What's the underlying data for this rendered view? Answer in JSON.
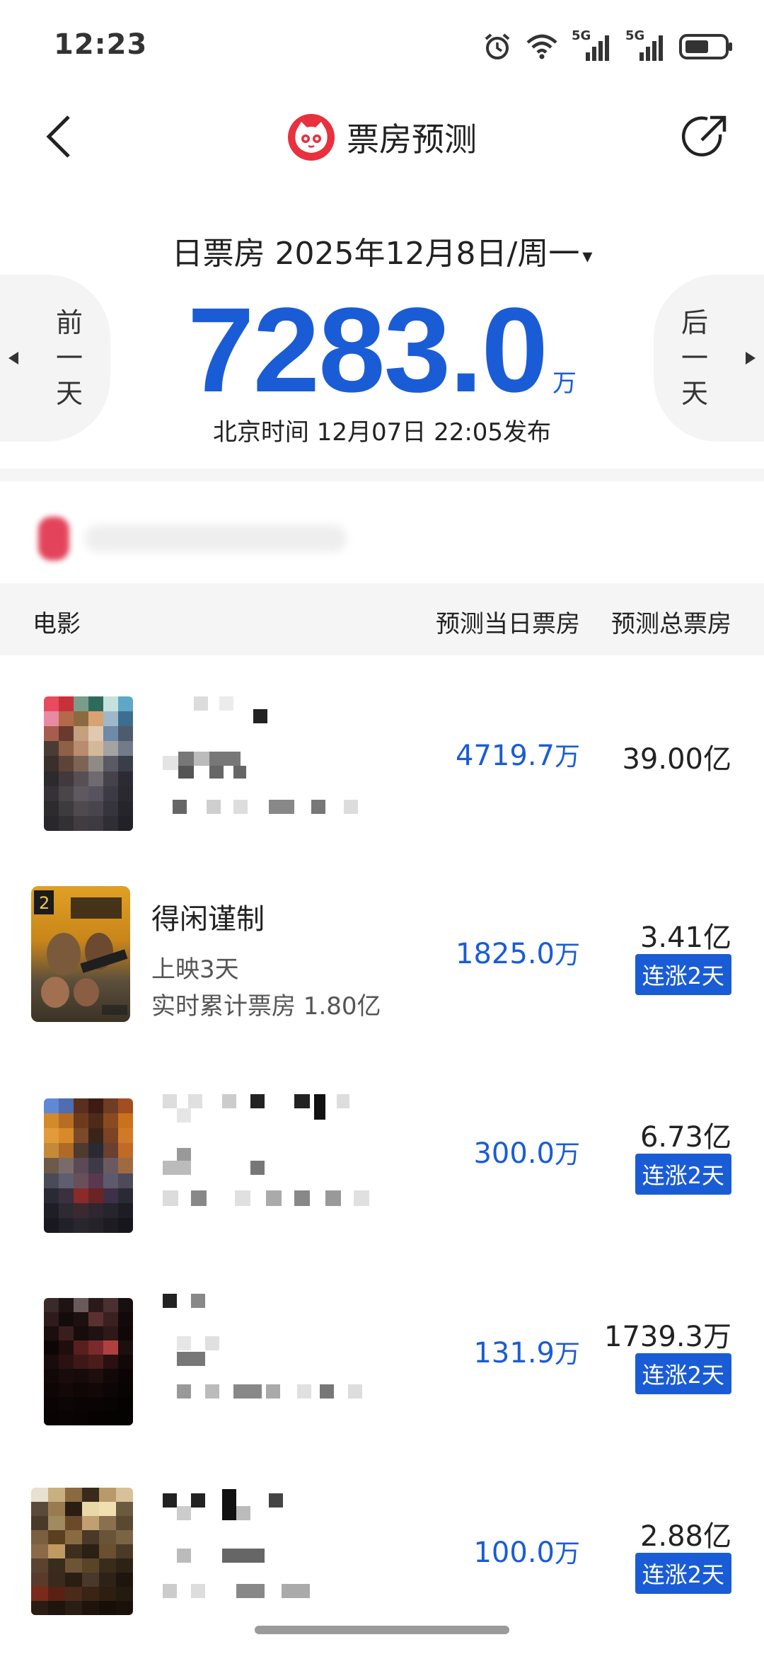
{
  "status_bar": {
    "time": "12:23",
    "icons": [
      "alarm-icon",
      "wifi-icon",
      "signal-5g-icon",
      "signal-5g-icon",
      "battery-icon"
    ],
    "network_1": "5G",
    "network_2": "5G"
  },
  "nav": {
    "title": "票房预测",
    "back_icon": "chevron-left-icon",
    "share_icon": "share-icon",
    "logo_icon": "maoyan-cat-logo"
  },
  "date_selector": {
    "label": "日票房 2025年12月8日/周一",
    "caret": "▾"
  },
  "prev_day": {
    "l1": "前",
    "l2": "一",
    "l3": "天"
  },
  "next_day": {
    "l1": "后",
    "l2": "一",
    "l3": "天"
  },
  "box_office": {
    "value": "7283.0",
    "unit": "万",
    "publish_time": "北京时间  12月07日  22:05发布"
  },
  "table": {
    "headers": {
      "movie": "电影",
      "daily": "预测当日票房",
      "total": "预测总票房"
    },
    "rows": [
      {
        "title": "",
        "sub1": "",
        "sub2": "",
        "daily": "4719.7",
        "daily_unit": "万",
        "total": "39.00",
        "total_unit": "亿",
        "badge": ""
      },
      {
        "title": "得闲谨制",
        "sub1": "上映3天",
        "sub2": "实时累计票房 1.80亿",
        "daily": "1825.0",
        "daily_unit": "万",
        "total": "3.41",
        "total_unit": "亿",
        "badge": "连涨2天"
      },
      {
        "title": "",
        "sub1": "",
        "sub2": "",
        "daily": "300.0",
        "daily_unit": "万",
        "total": "6.73",
        "total_unit": "亿",
        "badge": "连涨2天"
      },
      {
        "title": "",
        "sub1": "",
        "sub2": "",
        "daily": "131.9",
        "daily_unit": "万",
        "total": "1739.3",
        "total_unit": "万",
        "badge": "连涨2天"
      },
      {
        "title": "",
        "sub1": "",
        "sub2": "",
        "daily": "100.0",
        "daily_unit": "万",
        "total": "2.88",
        "total_unit": "亿",
        "badge": "连涨2天"
      }
    ]
  },
  "colors": {
    "accent_blue": "#1a5cd6",
    "logo_red": "#e8303e"
  }
}
